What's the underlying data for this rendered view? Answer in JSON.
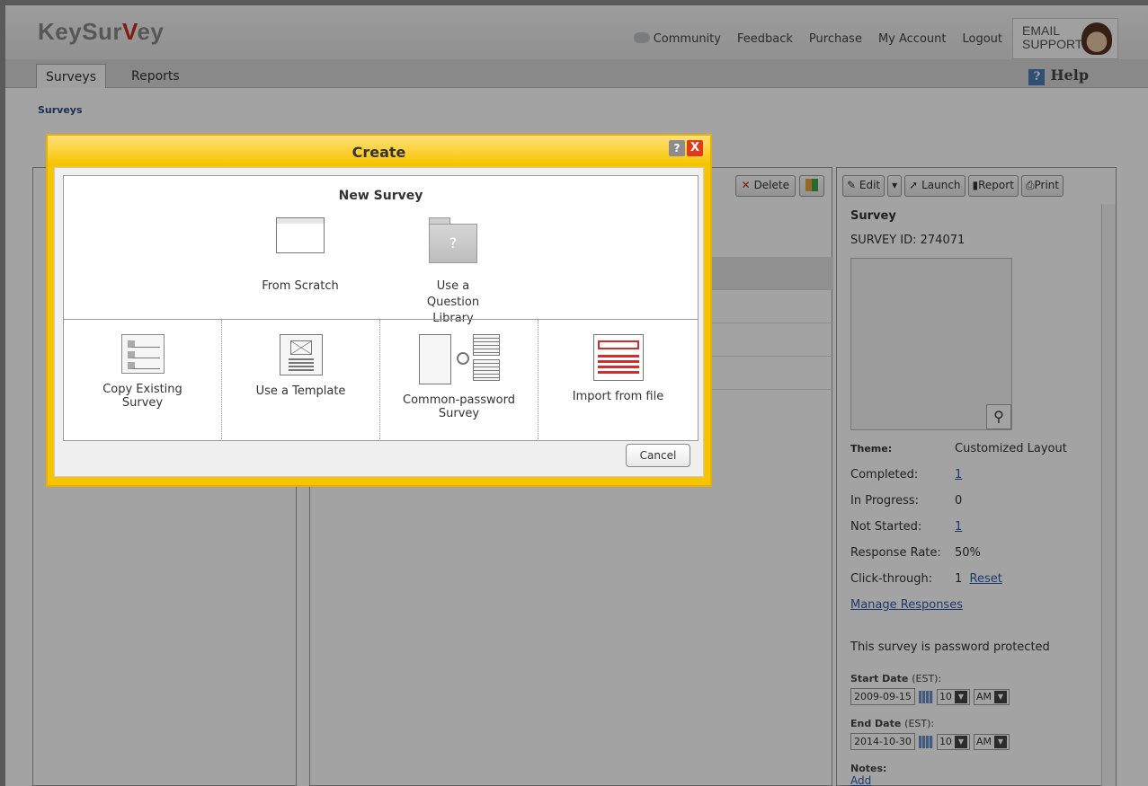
{
  "app": {
    "logo_text": "KeySurvey"
  },
  "top_links": {
    "community": "Community",
    "feedback": "Feedback",
    "purchase": "Purchase",
    "my_account": "My Account",
    "logout": "Logout"
  },
  "support": {
    "label": "EMAIL SUPPORT"
  },
  "nav": {
    "tabs": [
      {
        "label": "Surveys"
      },
      {
        "label": "Reports"
      }
    ],
    "help": "Help"
  },
  "breadcrumb": "Surveys",
  "middle_toolbar": {
    "delete": "Delete"
  },
  "right_toolbar": {
    "edit": "Edit",
    "launch": "Launch",
    "report": "Report",
    "print": "Print"
  },
  "survey_info": {
    "title": "Survey",
    "survey_id": "SURVEY ID: 274071",
    "theme_label": "Theme:",
    "theme_value": "Customized Layout",
    "completed_label": "Completed:",
    "completed_value": "1",
    "in_progress_label": "In Progress:",
    "in_progress_value": "0",
    "not_started_label": "Not Started:",
    "not_started_value": "1",
    "response_rate_label": "Response Rate:",
    "response_rate_value": "50%",
    "click_through_label": "Click-through:",
    "click_through_value": "1",
    "reset_link": "Reset",
    "manage_responses": "Manage Responses",
    "password_note": "This survey is password protected",
    "start_date_label": "Start Date",
    "start_date_tz": "(EST):",
    "start_date": "2009-09-15",
    "start_hour": "10",
    "start_ampm": "AM",
    "end_date_label": "End Date",
    "end_date_tz": "(EST):",
    "end_date": "2014-10-30",
    "end_hour": "10",
    "end_ampm": "AM",
    "notes_label": "Notes:",
    "notes_add": "Add"
  },
  "dialog": {
    "title": "Create",
    "help_btn": "?",
    "close_btn": "X",
    "section_title": "New Survey",
    "options_top": [
      {
        "label": "From Scratch"
      },
      {
        "label": "Use a Question Library"
      }
    ],
    "options_bottom": [
      {
        "label": "Copy Existing Survey"
      },
      {
        "label": "Use a Template"
      },
      {
        "label": "Common-password Survey"
      },
      {
        "label": "Import from file"
      }
    ],
    "cancel": "Cancel"
  },
  "colors": {
    "dialog_border": "#f7c400",
    "brand_red": "#cc2a1b",
    "link": "#2e5aa8"
  }
}
